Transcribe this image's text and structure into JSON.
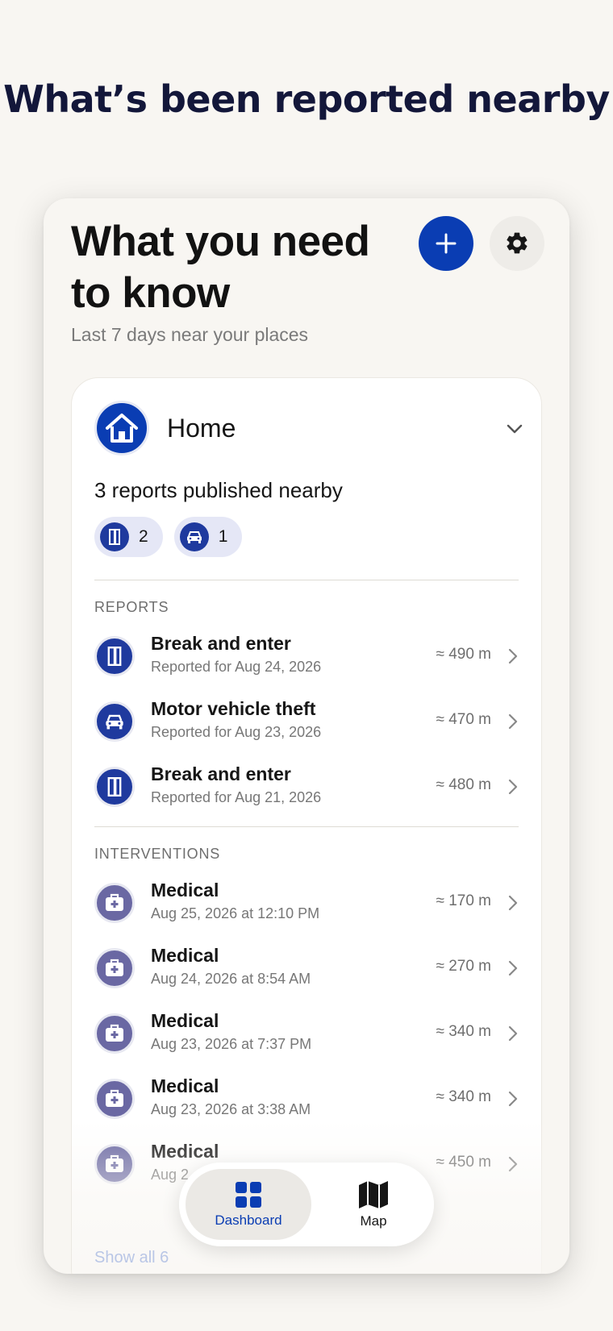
{
  "headline": "What’s been reported nearby",
  "screen": {
    "title": "What you need to know",
    "subtitle": "Last 7 days near your places"
  },
  "place": {
    "name": "Home",
    "summary": "3 reports published nearby",
    "chips": [
      {
        "icon": "door-icon",
        "count": "2"
      },
      {
        "icon": "car-icon",
        "count": "1"
      }
    ]
  },
  "reports": {
    "label": "REPORTS",
    "items": [
      {
        "title": "Break and enter",
        "subtitle": "Reported for Aug 24, 2026",
        "distance": "≈ 490 m",
        "icon": "door-icon"
      },
      {
        "title": "Motor vehicle theft",
        "subtitle": "Reported for Aug 23, 2026",
        "distance": "≈ 470 m",
        "icon": "car-icon"
      },
      {
        "title": "Break and enter",
        "subtitle": "Reported for Aug 21, 2026",
        "distance": "≈ 480 m",
        "icon": "door-icon"
      }
    ]
  },
  "interventions": {
    "label": "INTERVENTIONS",
    "items": [
      {
        "title": "Medical",
        "subtitle": "Aug 25, 2026 at 12:10 PM",
        "distance": "≈ 170 m",
        "icon": "medical-kit-icon"
      },
      {
        "title": "Medical",
        "subtitle": "Aug 24, 2026 at 8:54 AM",
        "distance": "≈ 270 m",
        "icon": "medical-kit-icon"
      },
      {
        "title": "Medical",
        "subtitle": "Aug 23, 2026 at 7:37 PM",
        "distance": "≈ 340 m",
        "icon": "medical-kit-icon"
      },
      {
        "title": "Medical",
        "subtitle": "Aug 23, 2026 at 3:38 AM",
        "distance": "≈ 340 m",
        "icon": "medical-kit-icon"
      },
      {
        "title": "Medical",
        "subtitle": "Aug 2",
        "distance": "≈ 450 m",
        "icon": "medical-kit-icon"
      }
    ]
  },
  "show_all": "Show all 6",
  "tabs": {
    "dashboard": "Dashboard",
    "map": "Map"
  },
  "colors": {
    "accent": "#0a3db3",
    "report_icon": "#1f3a9e",
    "medical_icon": "#6a68a3",
    "background": "#f8f6f2"
  }
}
